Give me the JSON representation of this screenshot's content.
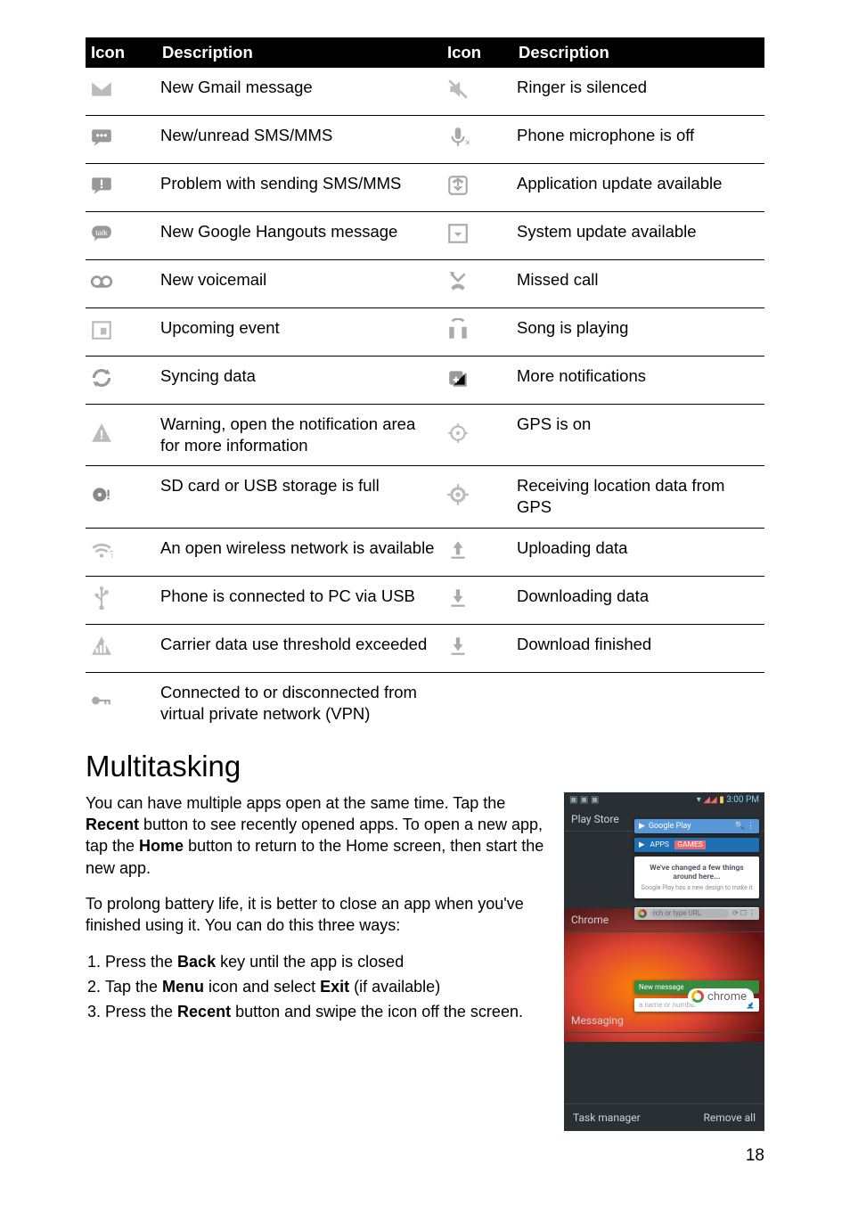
{
  "table": {
    "headers": [
      "Icon",
      "Description",
      "Icon",
      "Description"
    ],
    "rows": [
      {
        "l": "New Gmail message",
        "r": "Ringer is silenced",
        "li": "gmail",
        "ri": "silenced"
      },
      {
        "l": "New/unread SMS/MMS",
        "r": "Phone microphone is off",
        "li": "sms",
        "ri": "micoff"
      },
      {
        "l": "Problem with sending SMS/MMS",
        "r": "Application update available",
        "li": "smsprob",
        "ri": "appupd"
      },
      {
        "l": "New Google Hangouts message",
        "r": "System update available",
        "li": "talk",
        "ri": "sysupd"
      },
      {
        "l": "New voicemail",
        "r": "Missed call",
        "li": "vm",
        "ri": "missed"
      },
      {
        "l": "Upcoming event",
        "r": "Song is playing",
        "li": "event",
        "ri": "song"
      },
      {
        "l": "Syncing data",
        "r": "More notifications",
        "li": "sync",
        "ri": "more"
      },
      {
        "l": "Warning, open the notification area for more information",
        "r": "GPS is on",
        "li": "warn",
        "ri": "gpson"
      },
      {
        "l": "SD card or USB storage is full",
        "r": "Receiving location data from GPS",
        "li": "sdfull",
        "ri": "gpsrx"
      },
      {
        "l": "An open wireless network is available",
        "r": "Uploading data",
        "li": "wifi",
        "ri": "upload"
      },
      {
        "l": "Phone is connected to PC via USB",
        "r": "Downloading data",
        "li": "usb",
        "ri": "download"
      },
      {
        "l": "Carrier data use threshold exceeded",
        "r": "Download finished",
        "li": "datathr",
        "ri": "dlfin"
      },
      {
        "l": "Connected to or disconnected from virtual private network (VPN)",
        "r": "",
        "li": "vpn",
        "ri": ""
      }
    ]
  },
  "heading": "Multitasking",
  "para1_pre": "You can have multiple apps open at the same time. Tap the ",
  "para1_b1": "Recent",
  "para1_mid": " button to see recently opened apps. To open a new app, tap the ",
  "para1_b2": "Home",
  "para1_post": " button to return to the Home screen, then start the new app.",
  "para2": "To prolong battery life, it is better to close an app when you've finished using it. You can do this three ways:",
  "list": [
    {
      "pre": "Press the ",
      "b": "Back",
      "post": " key until the app is closed"
    },
    {
      "pre": "Tap the ",
      "b": "Menu",
      "post": " icon and select ",
      "b2": "Exit",
      "post2": " (if available)"
    },
    {
      "pre": "Press the ",
      "b": "Recent",
      "post": " button and swipe the icon off the screen."
    }
  ],
  "screenshot": {
    "time": "3:00 PM",
    "apps": [
      "Play Store",
      "Chrome",
      "Messaging"
    ],
    "card_top": "Google Play",
    "card_apps": "APPS",
    "card_games": "GAMES",
    "card_big": "We've changed a few things around here...",
    "card_sub": "Google Play has a new design to make it",
    "chrome_label": "chrome",
    "msg_title": "New message",
    "msg_sub": "a name or number",
    "btm_left": "Task manager",
    "btm_right": "Remove all"
  },
  "pagenum": "18"
}
